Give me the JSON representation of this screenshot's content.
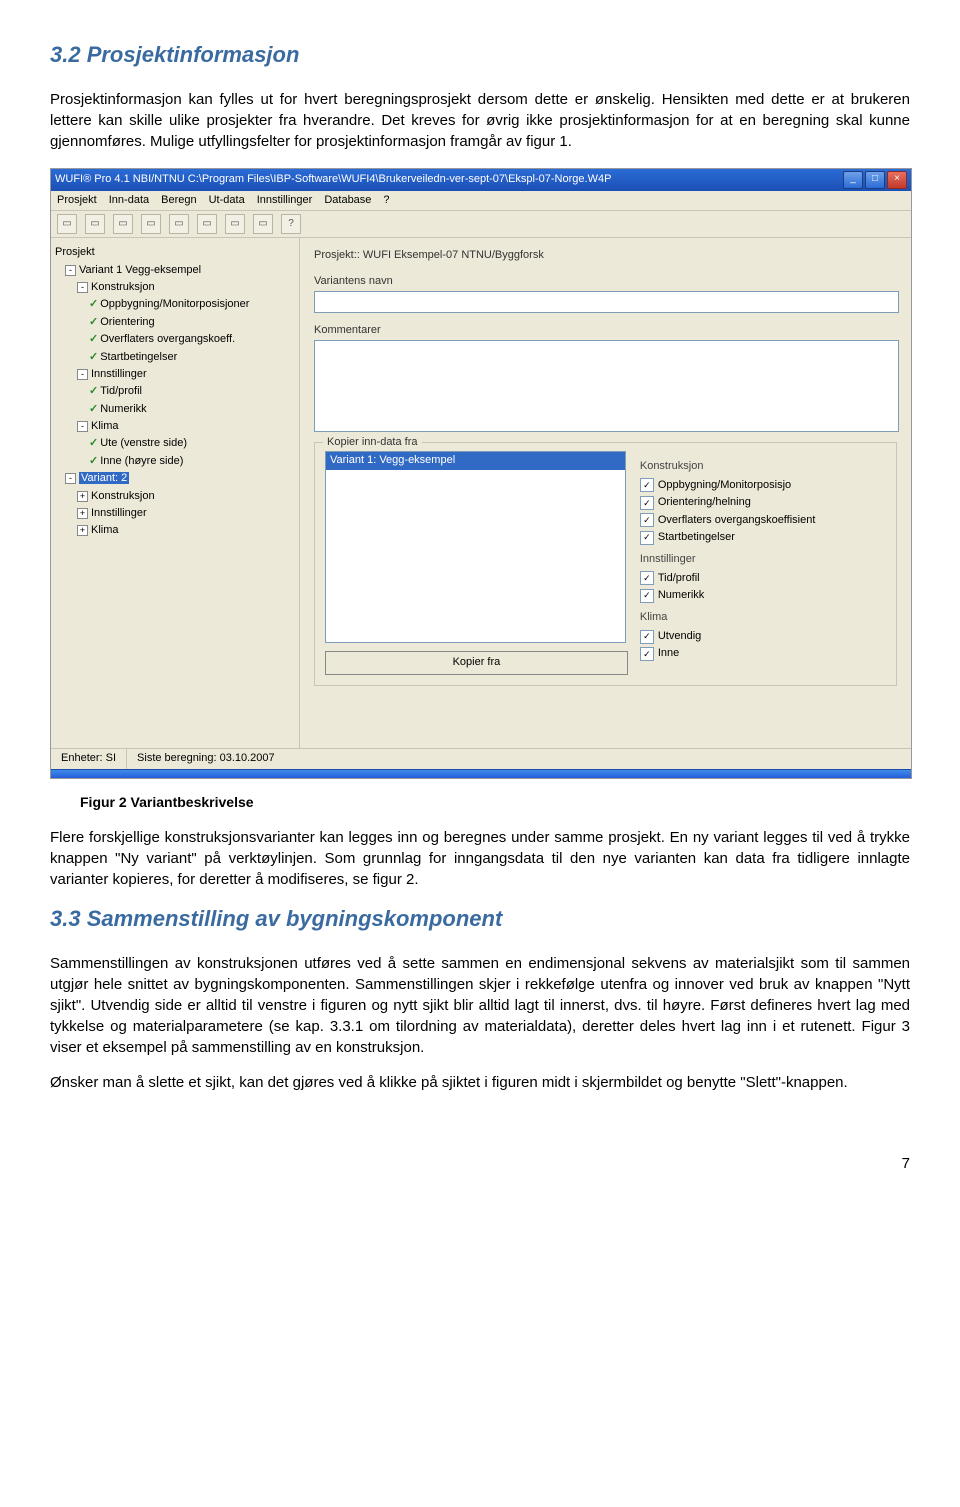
{
  "section32": {
    "heading": "3.2   Prosjektinformasjon",
    "para": "Prosjektinformasjon kan fylles ut for hvert beregningsprosjekt dersom dette er ønskelig. Hensikten med dette er at brukeren lettere kan skille ulike prosjekter fra hverandre. Det kreves for øvrig ikke prosjektinformasjon for at en beregning skal kunne gjennomføres. Mulige utfyllingsfelter for prosjektinformasjon framgår av figur 1."
  },
  "screenshot": {
    "titlebar": "WUFI® Pro 4.1 NBI/NTNU     C:\\Program Files\\IBP-Software\\WUFI4\\Brukerveiledn-ver-sept-07\\Ekspl-07-Norge.W4P",
    "menus": [
      "Prosjekt",
      "Inn-data",
      "Beregn",
      "Ut-data",
      "Innstillinger",
      "Database",
      "?"
    ],
    "tree": {
      "root": "Prosjekt",
      "v1": "Variant 1 Vegg-eksempel",
      "kon": "Konstruksjon",
      "opp": "Oppbygning/Monitorposisjoner",
      "ori": "Orientering",
      "ovf": "Overflaters overgangskoeff.",
      "stb": "Startbetingelser",
      "inn": "Innstillinger",
      "tid": "Tid/profil",
      "num": "Numerikk",
      "kli": "Klima",
      "ute": "Ute (venstre side)",
      "inne": "Inne (høyre side)",
      "v2": "Variant: 2",
      "kon2": "Konstruksjon",
      "inn2": "Innstillinger",
      "kli2": "Klima"
    },
    "form": {
      "project_label": "Prosjekt::  WUFI Eksempel-07 NTNU/Byggforsk",
      "variant_name_label": "Variantens navn",
      "kommentarer_label": "Kommentarer",
      "kopier_legend": "Kopier inn-data fra",
      "list_item": "Variant 1: Vegg-eksempel",
      "cat_kon": "Konstruksjon",
      "o1": "Oppbygning/Monitorposisjo",
      "o2": "Orientering/helning",
      "o3": "Overflaters overgangskoeffisient",
      "o4": "Startbetingelser",
      "cat_inn": "Innstillinger",
      "o5": "Tid/profil",
      "o6": "Numerikk",
      "cat_kli": "Klima",
      "o7": "Utvendig",
      "o8": "Inne",
      "kopier_btn": "Kopier fra"
    },
    "status": {
      "enheter": "Enheter: SI",
      "siste": "Siste beregning: 03.10.2007"
    }
  },
  "caption": "Figur 2 Variantbeskrivelse",
  "para_after1": "Flere forskjellige konstruksjonsvarianter kan legges inn og beregnes under samme prosjekt. En ny variant legges til ved å trykke knappen \"Ny variant\" på verktøylinjen. Som grunnlag for inngangsdata til den nye varianten kan data fra tidligere innlagte varianter kopieres, for deretter å modifiseres, se figur 2.",
  "section33": {
    "heading": "3.3    Sammenstilling av bygningskomponent",
    "para1": "Sammenstillingen av konstruksjonen utføres ved å sette sammen en endimensjonal sekvens av materialsjikt som til sammen utgjør hele snittet av bygningskomponenten. Sammenstillingen skjer i rekkefølge utenfra og innover ved bruk av knappen \"Nytt sjikt\". Utvendig side er alltid til venstre i figuren og nytt sjikt blir alltid lagt til innerst, dvs. til høyre. Først defineres hvert lag med tykkelse og materialparametere (se kap. 3.3.1 om tilordning av materialdata), deretter deles hvert lag inn i et rutenett. Figur 3 viser et eksempel på sammenstilling av en konstruksjon.",
    "para2": "Ønsker man å slette et sjikt, kan det gjøres ved å klikke på sjiktet i figuren midt i skjermbildet og benytte \"Slett\"-knappen."
  },
  "page_number": "7"
}
